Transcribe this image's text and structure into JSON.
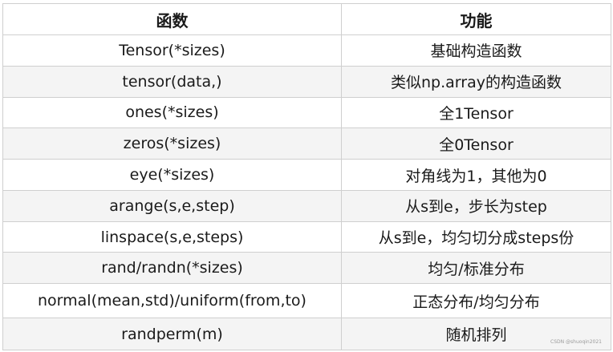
{
  "table": {
    "headers": [
      "函数",
      "功能"
    ],
    "rows": [
      [
        "Tensor(*sizes)",
        "基础构造函数"
      ],
      [
        "tensor(data,)",
        "类似np.array的构造函数"
      ],
      [
        "ones(*sizes)",
        "全1Tensor"
      ],
      [
        "zeros(*sizes)",
        "全0Tensor"
      ],
      [
        "eye(*sizes)",
        "对角线为1，其他为0"
      ],
      [
        "arange(s,e,step)",
        "从s到e，步长为step"
      ],
      [
        "linspace(s,e,steps)",
        "从s到e，均匀切分成steps份"
      ],
      [
        "rand/randn(*sizes)",
        "均匀/标准分布"
      ],
      [
        "normal(mean,std)/uniform(from,to)",
        "正态分布/均匀分布"
      ],
      [
        "randperm(m)",
        "随机排列"
      ]
    ]
  },
  "watermark": "CSDN @shuoqin2021"
}
